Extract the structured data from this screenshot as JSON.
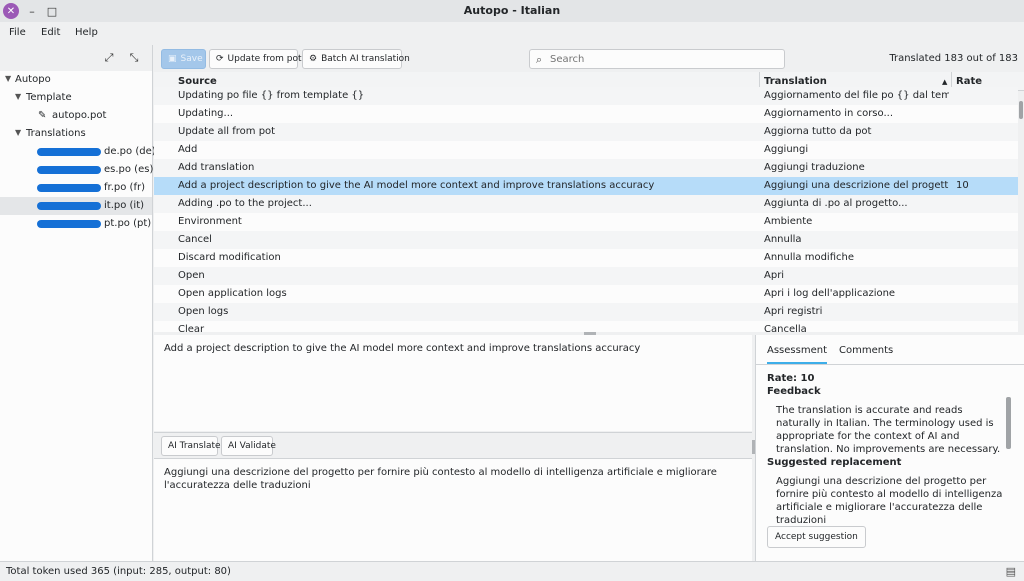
{
  "window": {
    "title": "Autopo - Italian",
    "close_icon": "x-icon",
    "minimize_label": "–",
    "maximize_label": "□"
  },
  "menu": [
    "File",
    "Edit",
    "Help"
  ],
  "sidebar": {
    "expand_icon": "⤢",
    "collapse_icon": "⤡",
    "tree": {
      "root": "Autopo",
      "template_group": "Template",
      "template_file": "autopo.pot",
      "translations_group": "Translations",
      "translations": [
        {
          "label": "de.po (de)"
        },
        {
          "label": "es.po (es)"
        },
        {
          "label": "fr.po (fr)"
        },
        {
          "label": "it.po (it)"
        },
        {
          "label": "pt.po (pt)"
        }
      ]
    }
  },
  "toolbar": {
    "save_label": "Save",
    "update_label": "Update from pot",
    "batch_label": "Batch AI translation",
    "search_placeholder": "Search",
    "translated_count": "Translated 183 out of 183"
  },
  "table": {
    "headers": {
      "source": "Source",
      "translation": "Translation",
      "sort_indicator": "▲",
      "rate": "Rate"
    },
    "rows": [
      {
        "source": "Updating po file {} from template {}",
        "translation": "Aggiornamento del file po {} dal templat...",
        "rate": ""
      },
      {
        "source": "Updating...",
        "translation": "Aggiornamento in corso...",
        "rate": ""
      },
      {
        "source": "Update all from pot",
        "translation": "Aggiorna tutto da pot",
        "rate": ""
      },
      {
        "source": "Add",
        "translation": "Aggiungi",
        "rate": ""
      },
      {
        "source": "Add translation",
        "translation": "Aggiungi traduzione",
        "rate": ""
      },
      {
        "source": "Add a project description to give the AI model more context and improve translations accuracy",
        "translation": "Aggiungi una descrizione del progetto p...",
        "rate": "10"
      },
      {
        "source": "Adding .po to the project...",
        "translation": "Aggiunta di .po al progetto...",
        "rate": ""
      },
      {
        "source": "Environment",
        "translation": "Ambiente",
        "rate": ""
      },
      {
        "source": "Cancel",
        "translation": "Annulla",
        "rate": ""
      },
      {
        "source": "Discard modification",
        "translation": "Annulla modifiche",
        "rate": ""
      },
      {
        "source": "Open",
        "translation": "Apri",
        "rate": ""
      },
      {
        "source": "Open application logs",
        "translation": "Apri i log dell'applicazione",
        "rate": ""
      },
      {
        "source": "Open logs",
        "translation": "Apri registri",
        "rate": ""
      },
      {
        "source": "Clear",
        "translation": "Cancella",
        "rate": ""
      }
    ]
  },
  "editor": {
    "source_text": "Add a project description to give the AI model more context and improve translations accuracy",
    "ai_translate_label": "AI Translate",
    "ai_validate_label": "AI Validate",
    "target_text": "Aggiungi una descrizione del progetto per fornire più contesto al modello di intelligenza artificiale e migliorare l'accuratezza delle traduzioni"
  },
  "assessment": {
    "tab_assessment": "Assessment",
    "tab_comments": "Comments",
    "rate": "Rate: 10",
    "feedback_label": "Feedback",
    "feedback_text": "The translation is accurate and reads naturally in Italian. The terminology used is appropriate for the context of AI and translation. No improvements are necessary.",
    "suggested_label": "Suggested replacement",
    "suggested_text": "Aggiungi una descrizione del progetto per fornire più contesto al modello di intelligenza artificiale e migliorare l'accuratezza delle traduzioni",
    "accept_label": "Accept suggestion"
  },
  "status": {
    "text": "Total token used 365 (input: 285, output: 80)",
    "icon": "document-icon"
  }
}
